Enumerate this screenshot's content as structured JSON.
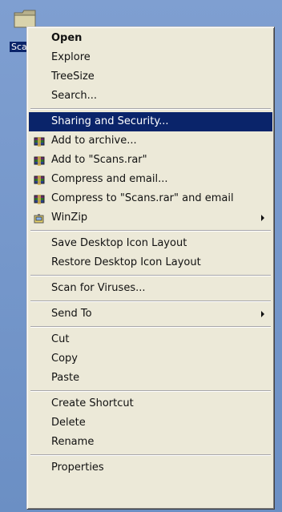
{
  "desktop_icon": {
    "label": "Sca"
  },
  "menu": {
    "groups": [
      [
        {
          "text": "Open",
          "bold": true,
          "icon": null,
          "submenu": false,
          "active": false
        },
        {
          "text": "Explore",
          "bold": false,
          "icon": null,
          "submenu": false,
          "active": false
        },
        {
          "text": "TreeSize",
          "bold": false,
          "icon": null,
          "submenu": false,
          "active": false
        },
        {
          "text": "Search...",
          "bold": false,
          "icon": null,
          "submenu": false,
          "active": false
        }
      ],
      [
        {
          "text": "Sharing and Security...",
          "bold": false,
          "icon": null,
          "submenu": false,
          "active": true
        },
        {
          "text": "Add to archive...",
          "bold": false,
          "icon": "winrar-icon",
          "submenu": false,
          "active": false
        },
        {
          "text": "Add to \"Scans.rar\"",
          "bold": false,
          "icon": "winrar-icon",
          "submenu": false,
          "active": false
        },
        {
          "text": "Compress and email...",
          "bold": false,
          "icon": "winrar-icon",
          "submenu": false,
          "active": false
        },
        {
          "text": "Compress to \"Scans.rar\" and email",
          "bold": false,
          "icon": "winrar-icon",
          "submenu": false,
          "active": false
        },
        {
          "text": "WinZip",
          "bold": false,
          "icon": "winzip-icon",
          "submenu": true,
          "active": false
        }
      ],
      [
        {
          "text": "Save Desktop Icon Layout",
          "bold": false,
          "icon": null,
          "submenu": false,
          "active": false
        },
        {
          "text": "Restore Desktop Icon Layout",
          "bold": false,
          "icon": null,
          "submenu": false,
          "active": false
        }
      ],
      [
        {
          "text": "Scan for Viruses...",
          "bold": false,
          "icon": null,
          "submenu": false,
          "active": false
        }
      ],
      [
        {
          "text": "Send To",
          "bold": false,
          "icon": null,
          "submenu": true,
          "active": false
        }
      ],
      [
        {
          "text": "Cut",
          "bold": false,
          "icon": null,
          "submenu": false,
          "active": false
        },
        {
          "text": "Copy",
          "bold": false,
          "icon": null,
          "submenu": false,
          "active": false
        },
        {
          "text": "Paste",
          "bold": false,
          "icon": null,
          "submenu": false,
          "active": false
        }
      ],
      [
        {
          "text": "Create Shortcut",
          "bold": false,
          "icon": null,
          "submenu": false,
          "active": false
        },
        {
          "text": "Delete",
          "bold": false,
          "icon": null,
          "submenu": false,
          "active": false
        },
        {
          "text": "Rename",
          "bold": false,
          "icon": null,
          "submenu": false,
          "active": false
        }
      ],
      [
        {
          "text": "Properties",
          "bold": false,
          "icon": null,
          "submenu": false,
          "active": false
        }
      ]
    ]
  },
  "colors": {
    "menu_bg": "#ece9d8",
    "highlight": "#0a246a",
    "desktop": "#6b8fc4"
  }
}
